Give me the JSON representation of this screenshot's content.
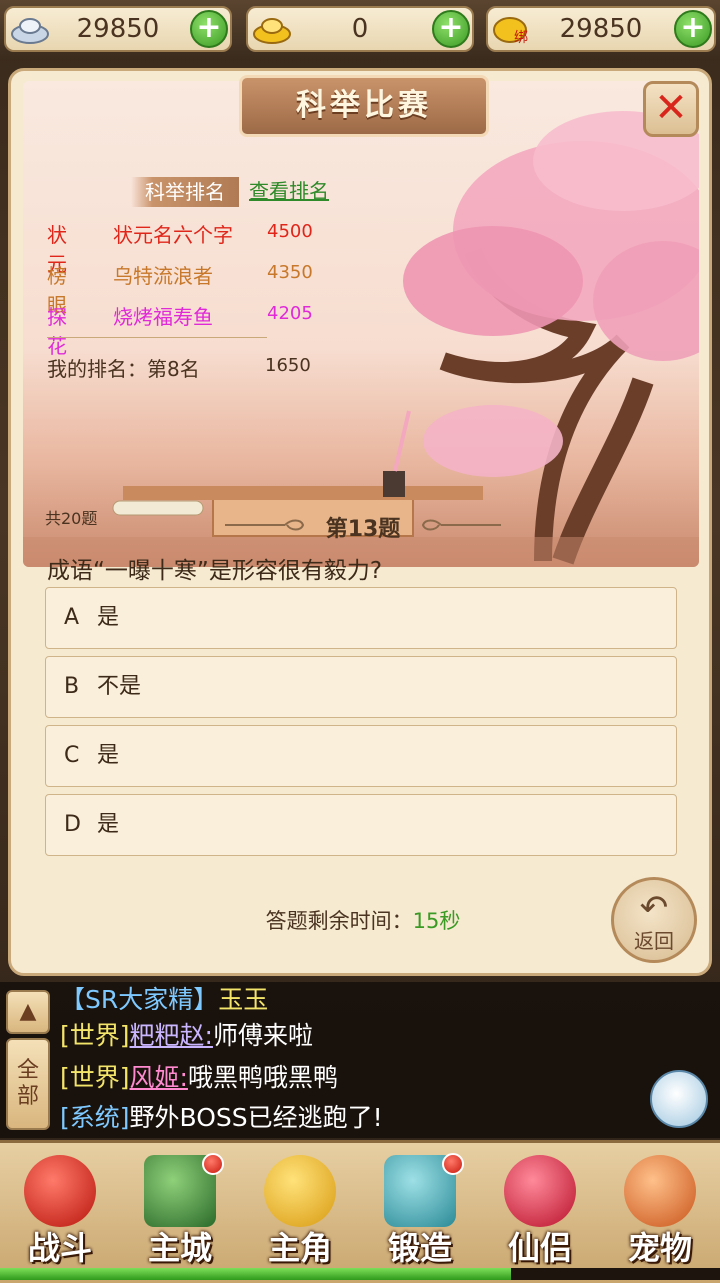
{
  "currency": [
    {
      "icon": "silver-ingot-icon",
      "value": "29850"
    },
    {
      "icon": "gold-ingot-icon",
      "value": "0"
    },
    {
      "icon": "bound-gold-icon",
      "badge": "绑",
      "value": "29850"
    }
  ],
  "panel": {
    "title": "科举比赛",
    "rank_header": "科举排名",
    "view_rank_link": "查看排名",
    "rankings": [
      {
        "title": "状元",
        "name": "状元名六个字",
        "score": "4500",
        "color": "#e0261a"
      },
      {
        "title": "榜眼",
        "name": "乌特流浪者",
        "score": "4350",
        "color": "#c8782a"
      },
      {
        "title": "探花",
        "name": "烧烤福寿鱼",
        "score": "4205",
        "color": "#e02ad8"
      }
    ],
    "my_rank_label": "我的排名：第8名",
    "my_score": "1650",
    "total_questions": "共20题",
    "question_number": "第13题",
    "question_text": "成语“一曝十寒”是形容很有毅力?",
    "options": [
      {
        "letter": "A",
        "text": "是"
      },
      {
        "letter": "B",
        "text": "不是"
      },
      {
        "letter": "C",
        "text": "是"
      },
      {
        "letter": "D",
        "text": "是"
      }
    ],
    "timer_label": "答题剩余时间：",
    "timer_value": "15秒",
    "back_label": "返回"
  },
  "chat": {
    "collapse_icon": "up-arrow-icon",
    "filter_label": "全部",
    "messages": [
      {
        "channel": "【SR大家精】",
        "name": "玉玉",
        "text": ""
      },
      {
        "channel": "[世界]",
        "name": "粑粑赵:",
        "text": "师傅来啦"
      },
      {
        "channel": "[世界]",
        "name": "风姬:",
        "text": "哦黑鸭哦黑鸭"
      },
      {
        "channel": "[系统]",
        "name": "",
        "text": "野外BOSS已经逃跑了!"
      }
    ]
  },
  "nav": [
    {
      "label": "战斗",
      "icon": "battle-icon",
      "badge": false,
      "color": "#e0302a"
    },
    {
      "label": "主城",
      "icon": "main-city-icon",
      "badge": true,
      "color": "#3a8a3a"
    },
    {
      "label": "主角",
      "icon": "hero-icon",
      "badge": false,
      "color": "#f2c11e"
    },
    {
      "label": "锻造",
      "icon": "forge-icon",
      "badge": true,
      "color": "#3aa6b0"
    },
    {
      "label": "仙侣",
      "icon": "partner-icon",
      "badge": false,
      "color": "#d8263a"
    },
    {
      "label": "宠物",
      "icon": "pet-icon",
      "badge": false,
      "color": "#e0742a"
    }
  ],
  "progress": 0.71
}
